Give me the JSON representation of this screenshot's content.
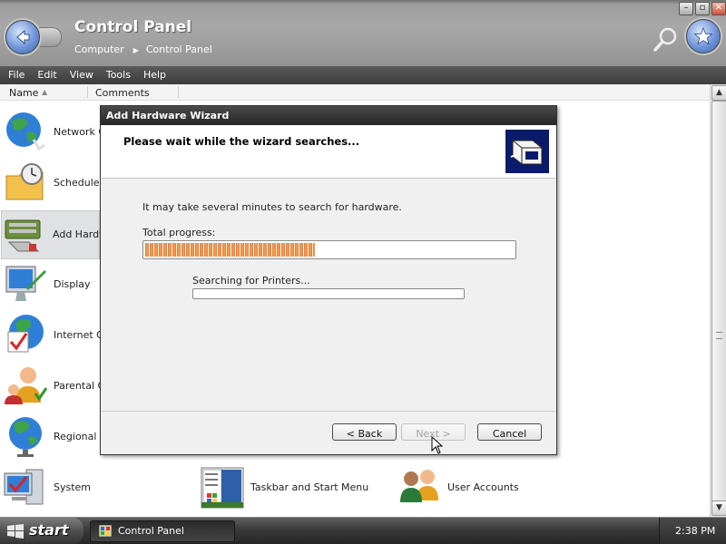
{
  "window": {
    "title": "Control Panel",
    "breadcrumb": [
      "Computer",
      "Control Panel"
    ],
    "breadcrumb_separator": "▶"
  },
  "menu": [
    "File",
    "Edit",
    "View",
    "Tools",
    "Help"
  ],
  "columns": {
    "name": "Name",
    "comments": "Comments"
  },
  "items": [
    {
      "label": "Network Co",
      "icon": "globe-network-icon"
    },
    {
      "label": "Scheduled T",
      "icon": "scheduled-tasks-icon"
    },
    {
      "label": "Add Hardw",
      "icon": "add-hardware-icon",
      "selected": true
    },
    {
      "label": "Display",
      "icon": "display-icon"
    },
    {
      "label": "Internet Op",
      "icon": "internet-options-icon"
    },
    {
      "label": "Parental Co",
      "icon": "parental-controls-icon"
    },
    {
      "label": "Regional ar",
      "icon": "regional-options-icon"
    },
    {
      "label": "System",
      "icon": "system-icon"
    },
    {
      "label": "Taskbar and Start Menu",
      "icon": "taskbar-start-menu-icon"
    },
    {
      "label": "User Accounts",
      "icon": "user-accounts-icon"
    }
  ],
  "dialog": {
    "title": "Add Hardware Wizard",
    "heading": "Please wait while the wizard searches...",
    "description": "It may take several minutes to search for hardware.",
    "total_label": "Total progress:",
    "total_progress": 0.46,
    "searching_label": "Searching for Printers...",
    "searching_progress": 0,
    "buttons": {
      "back": "< Back",
      "next": "Next >",
      "cancel": "Cancel"
    }
  },
  "taskbar": {
    "start_label": "start",
    "task_label": "Control Panel",
    "clock": "2:38 PM"
  },
  "colors": {
    "progress": "#e3741c",
    "header": "#9c9c9c",
    "menubar": "#3c3c3c"
  }
}
